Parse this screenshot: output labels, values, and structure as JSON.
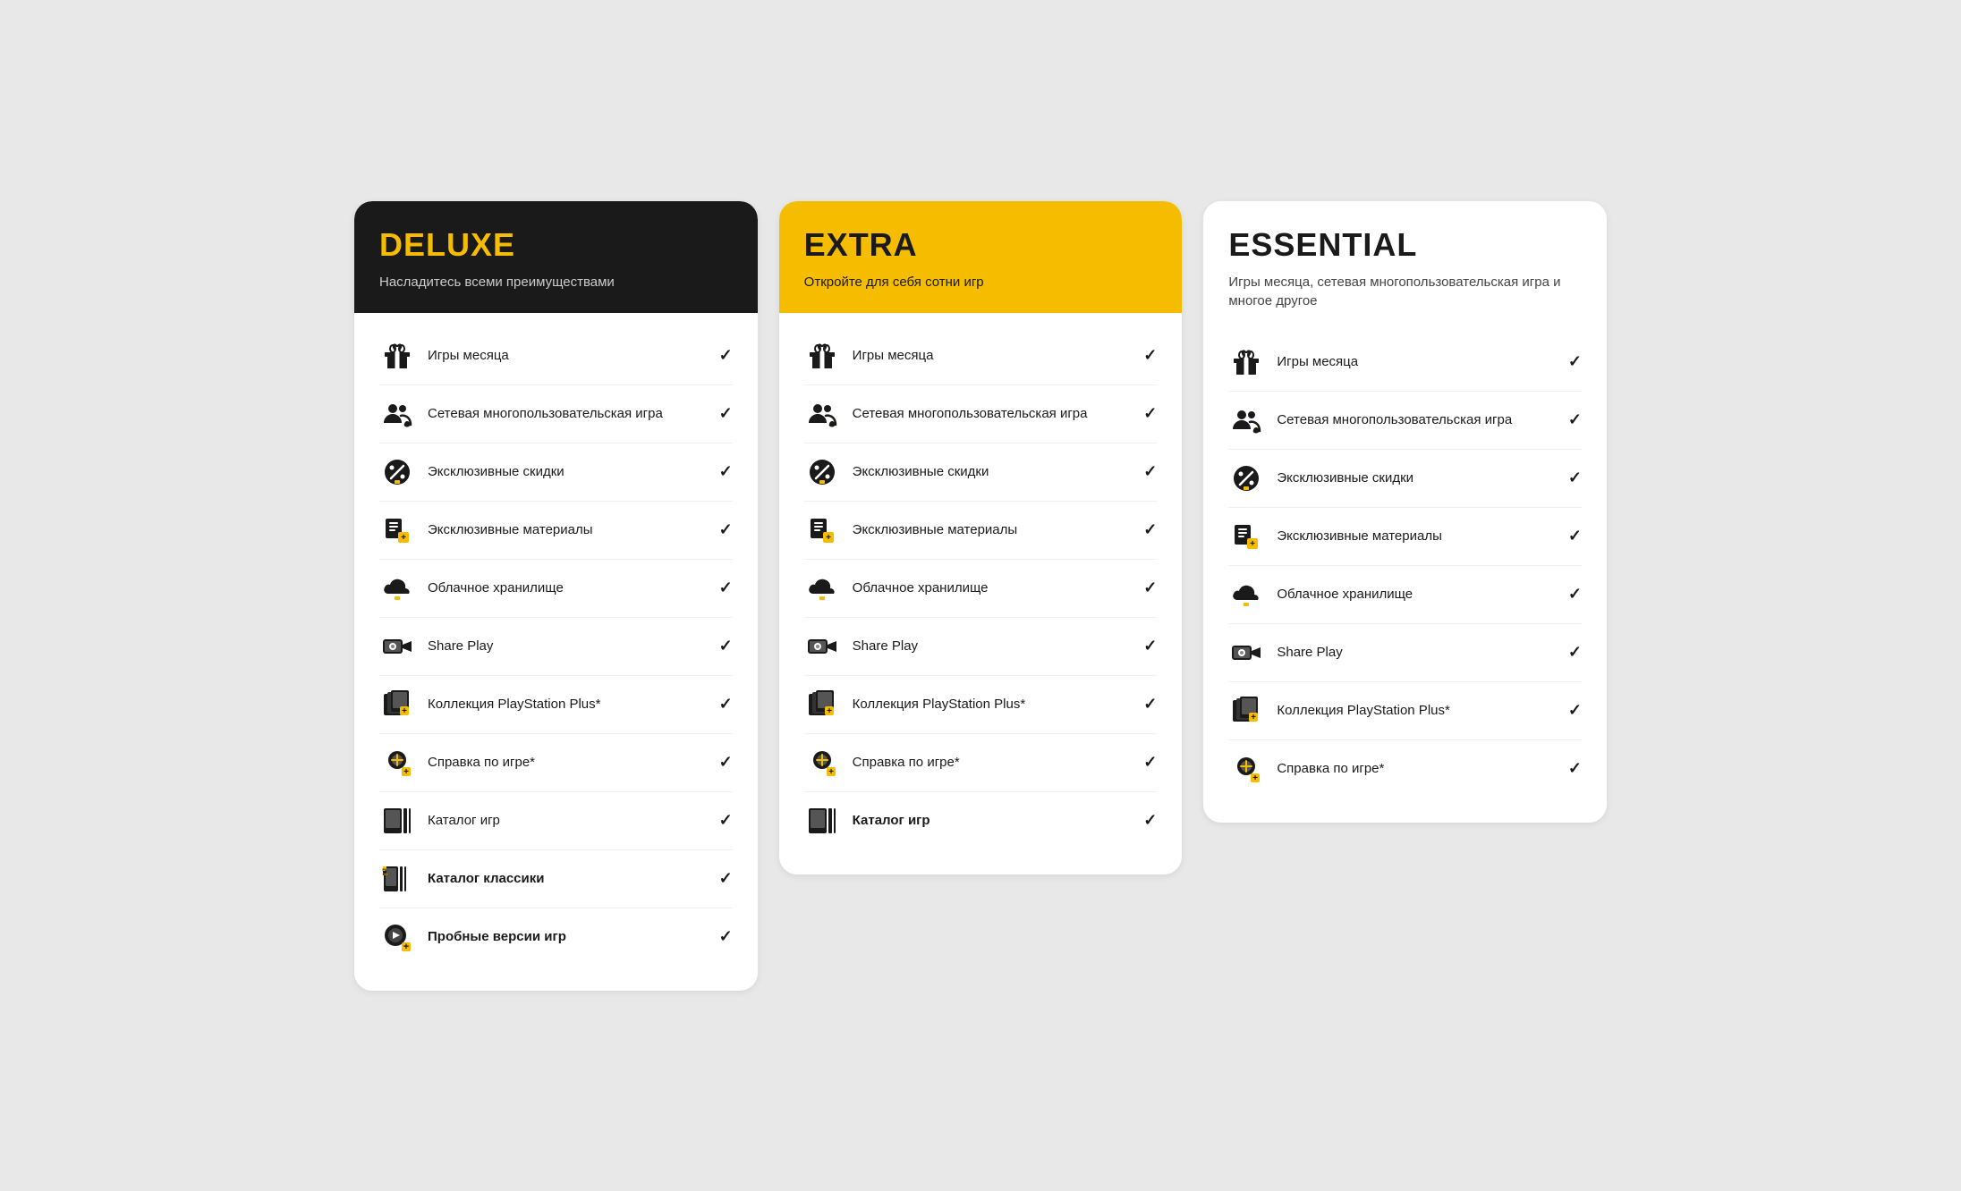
{
  "cards": [
    {
      "id": "deluxe",
      "headerStyle": "dark",
      "title": "DELUXE",
      "subtitle": "Насладитесь всеми преимуществами",
      "features": [
        {
          "icon": "gift",
          "label": "Игры месяца",
          "bold": false,
          "check": true
        },
        {
          "icon": "multiplayer",
          "label": "Сетевая многопользовательская игра",
          "bold": false,
          "check": true
        },
        {
          "icon": "discount",
          "label": "Эксклюзивные скидки",
          "bold": false,
          "check": true
        },
        {
          "icon": "materials",
          "label": "Эксклюзивные материалы",
          "bold": false,
          "check": true
        },
        {
          "icon": "cloud",
          "label": "Облачное хранилище",
          "bold": false,
          "check": true
        },
        {
          "icon": "shareplay",
          "label": "Share Play",
          "bold": false,
          "check": true
        },
        {
          "icon": "collection",
          "label": "Коллекция PlayStation Plus*",
          "bold": false,
          "check": true
        },
        {
          "icon": "hint",
          "label": "Справка по игре*",
          "bold": false,
          "check": true
        },
        {
          "icon": "catalog",
          "label": "Каталог игр",
          "bold": false,
          "check": true
        },
        {
          "icon": "classics",
          "label": "Каталог классики",
          "bold": true,
          "check": true
        },
        {
          "icon": "trial",
          "label": "Пробные версии игр",
          "bold": true,
          "check": true
        }
      ]
    },
    {
      "id": "extra",
      "headerStyle": "yellow",
      "title": "EXTRA",
      "subtitle": "Откройте для себя сотни игр",
      "features": [
        {
          "icon": "gift",
          "label": "Игры месяца",
          "bold": false,
          "check": true
        },
        {
          "icon": "multiplayer",
          "label": "Сетевая многопользовательская игра",
          "bold": false,
          "check": true
        },
        {
          "icon": "discount",
          "label": "Эксклюзивные скидки",
          "bold": false,
          "check": true
        },
        {
          "icon": "materials",
          "label": "Эксклюзивные материалы",
          "bold": false,
          "check": true
        },
        {
          "icon": "cloud",
          "label": "Облачное хранилище",
          "bold": false,
          "check": true
        },
        {
          "icon": "shareplay",
          "label": "Share Play",
          "bold": false,
          "check": true
        },
        {
          "icon": "collection",
          "label": "Коллекция PlayStation Plus*",
          "bold": false,
          "check": true
        },
        {
          "icon": "hint",
          "label": "Справка по игре*",
          "bold": false,
          "check": true
        },
        {
          "icon": "catalog",
          "label": "Каталог игр",
          "bold": true,
          "check": true
        }
      ]
    },
    {
      "id": "essential",
      "headerStyle": "light",
      "title": "ESSENTIAL",
      "subtitle": "Игры месяца, сетевая многопользовательская игра и многое другое",
      "features": [
        {
          "icon": "gift",
          "label": "Игры месяца",
          "bold": false,
          "check": true
        },
        {
          "icon": "multiplayer",
          "label": "Сетевая многопользовательская игра",
          "bold": false,
          "check": true
        },
        {
          "icon": "discount",
          "label": "Эксклюзивные скидки",
          "bold": false,
          "check": true
        },
        {
          "icon": "materials",
          "label": "Эксклюзивные материалы",
          "bold": false,
          "check": true
        },
        {
          "icon": "cloud",
          "label": "Облачное хранилище",
          "bold": false,
          "check": true
        },
        {
          "icon": "shareplay",
          "label": "Share Play",
          "bold": false,
          "check": true
        },
        {
          "icon": "collection",
          "label": "Коллекция PlayStation Plus*",
          "bold": false,
          "check": true
        },
        {
          "icon": "hint",
          "label": "Справка по игре*",
          "bold": false,
          "check": true
        }
      ]
    }
  ]
}
